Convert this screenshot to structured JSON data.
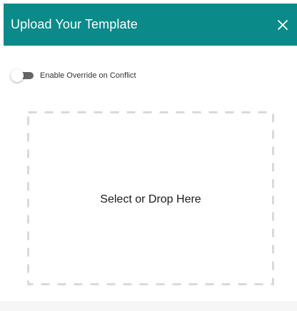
{
  "dialog": {
    "title": "Upload Your Template",
    "close_icon": "close-icon"
  },
  "override_toggle": {
    "label": "Enable Override on Conflict",
    "enabled": false
  },
  "dropzone": {
    "label": "Select or Drop Here"
  },
  "colors": {
    "header": "#0b8a8a",
    "header_text": "#ffffff",
    "toggle_track": "#666666",
    "dash": "#d9d9d9"
  }
}
